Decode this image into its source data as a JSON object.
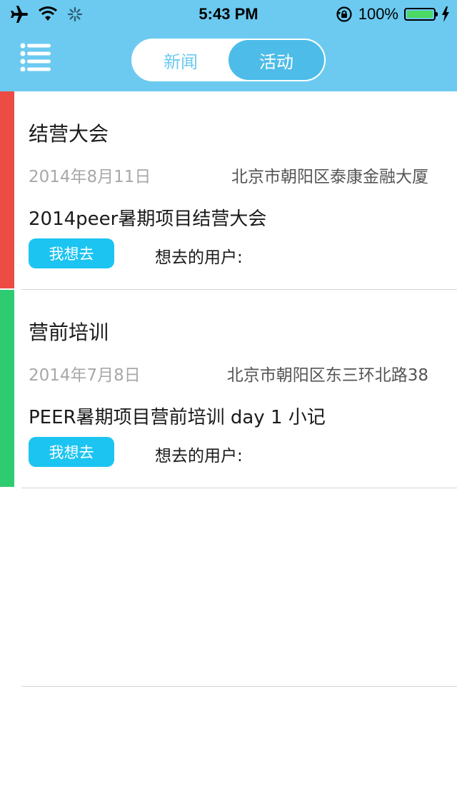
{
  "status_bar": {
    "icons": [
      "airplane-icon",
      "wifi-icon",
      "activity-spinner-icon"
    ],
    "time": "5:43 PM",
    "lock_icon": "rotation-lock-icon",
    "battery_percent": "100%",
    "battery_level": 1.0,
    "charging_icon": "bolt-icon"
  },
  "nav": {
    "menu_icon": "menu-list-icon",
    "tabs": [
      {
        "label": "新闻",
        "active": false
      },
      {
        "label": "活动",
        "active": true
      }
    ]
  },
  "events": [
    {
      "title": "结营大会",
      "date": "2014年8月11日",
      "location": "北京市朝阳区泰康金融大厦",
      "description": "2014peer暑期项目结营大会",
      "button_label": "我想去",
      "users_label": "想去的用户:",
      "accent_color": "#ec4c43"
    },
    {
      "title": "营前培训",
      "date": "2014年7月8日",
      "location": "北京市朝阳区东三环北路38",
      "description": "PEER暑期项目营前培训 day 1 小记",
      "button_label": "我想去",
      "users_label": "想去的用户:",
      "accent_color": "#2ecc71"
    }
  ],
  "colors": {
    "header_bg": "#6ccaf0",
    "segment_active": "#4dbce8",
    "button_bg": "#1cc4f2",
    "divider": "#d4d4d4"
  }
}
